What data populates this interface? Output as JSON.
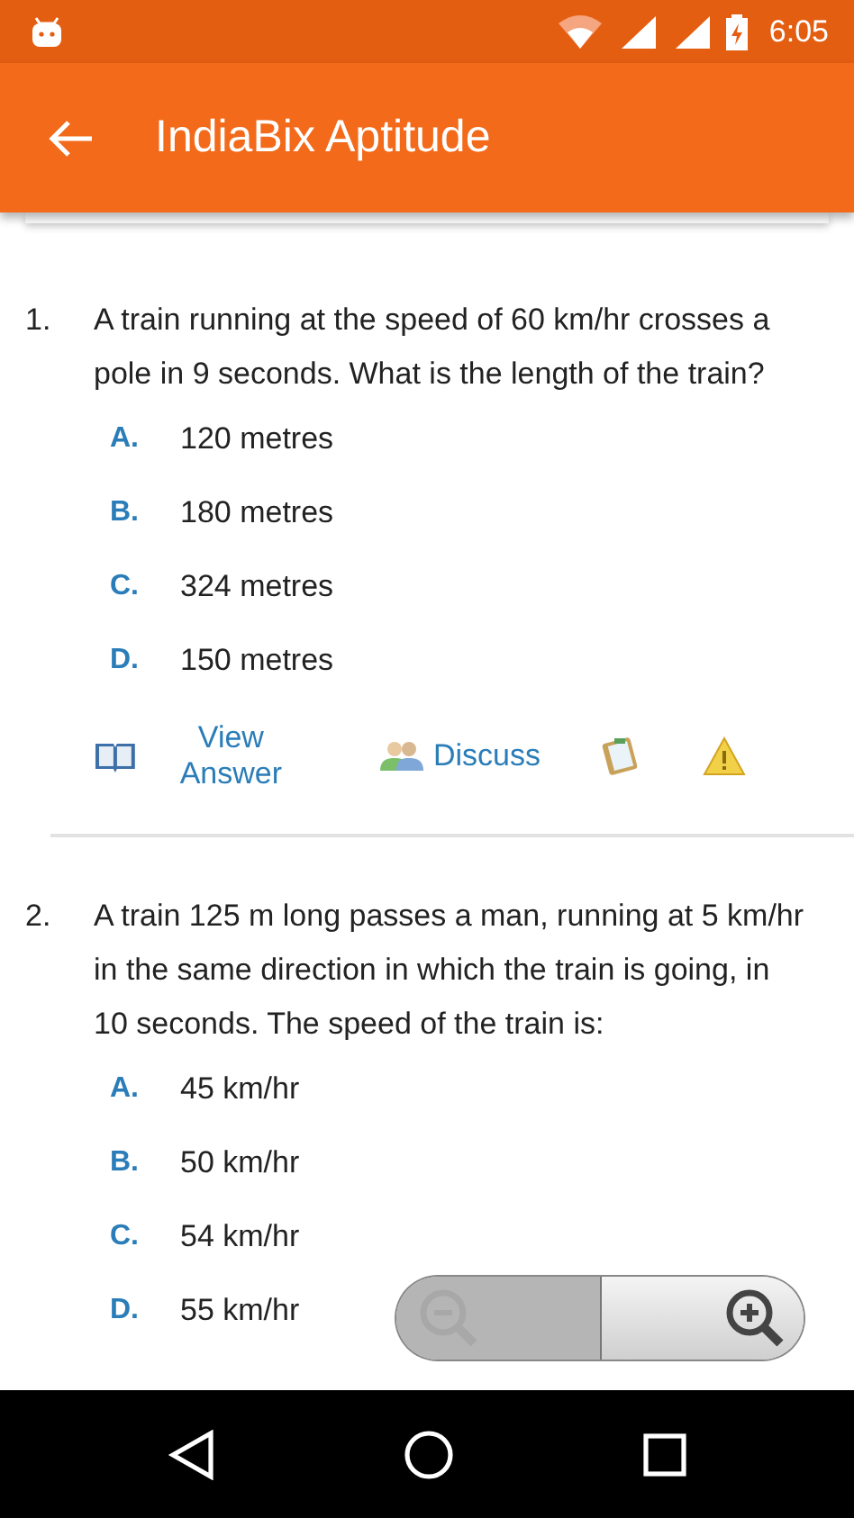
{
  "status_bar": {
    "time": "6:05"
  },
  "app_bar": {
    "title": "IndiaBix Aptitude"
  },
  "questions": [
    {
      "number": "1.",
      "text": "A train running at the speed of 60 km/hr crosses a pole in 9 seconds. What is the length of the train?",
      "options": [
        {
          "letter": "A.",
          "text": "120 metres"
        },
        {
          "letter": "B.",
          "text": "180 metres"
        },
        {
          "letter": "C.",
          "text": "324 metres"
        },
        {
          "letter": "D.",
          "text": "150 metres"
        }
      ],
      "actions": [
        {
          "kind": "answer",
          "label": "View Answer"
        },
        {
          "kind": "discuss",
          "label": "Discuss"
        },
        {
          "kind": "notebook"
        },
        {
          "kind": "report"
        }
      ]
    },
    {
      "number": "2.",
      "text": "A train 125 m long passes a man, running at 5 km/hr in the same direction in which the train is going, in 10 seconds. The speed of the train is:",
      "options": [
        {
          "letter": "A.",
          "text": "45 km/hr"
        },
        {
          "letter": "B.",
          "text": "50 km/hr"
        },
        {
          "letter": "C.",
          "text": "54 km/hr"
        },
        {
          "letter": "D.",
          "text": "55 km/hr"
        }
      ]
    }
  ],
  "zoom_controls": [
    {
      "kind": "zoom_out",
      "disabled": true
    },
    {
      "kind": "zoom_in",
      "disabled": false
    }
  ]
}
